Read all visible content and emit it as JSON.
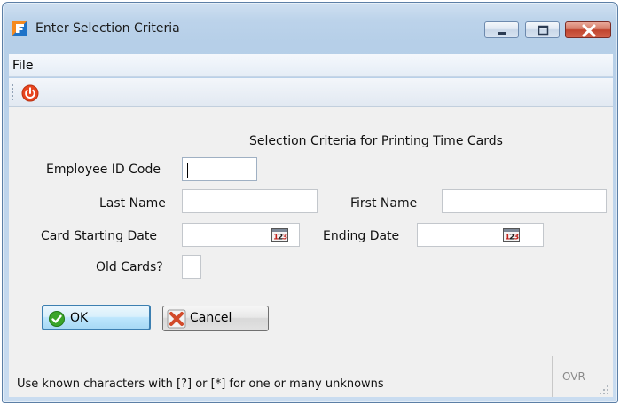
{
  "window": {
    "title": "Enter Selection Criteria",
    "app_icon": "f-app-icon"
  },
  "menu": {
    "items": [
      {
        "label": "File"
      }
    ]
  },
  "toolbar": {
    "power_icon": "power-icon",
    "power_color": "#e8451f"
  },
  "form": {
    "heading": "Selection Criteria for Printing Time Cards",
    "employee_id": {
      "label": "Employee ID Code",
      "value": ""
    },
    "last_name": {
      "label": "Last Name",
      "value": ""
    },
    "first_name": {
      "label": "First Name",
      "value": ""
    },
    "card_start": {
      "label": "Card Starting Date",
      "value": ""
    },
    "ending_date": {
      "label": "Ending Date",
      "value": ""
    },
    "old_cards": {
      "label": "Old Cards?",
      "value": ""
    }
  },
  "buttons": {
    "ok": {
      "label": "OK",
      "icon": "check-icon",
      "color": "#3aa52a"
    },
    "cancel": {
      "label": "Cancel",
      "icon": "cancel-x-icon",
      "color": "#d24a2a"
    }
  },
  "status": {
    "message": "Use known characters with [?] or [*] for one or many unknowns",
    "mode": "OVR"
  }
}
